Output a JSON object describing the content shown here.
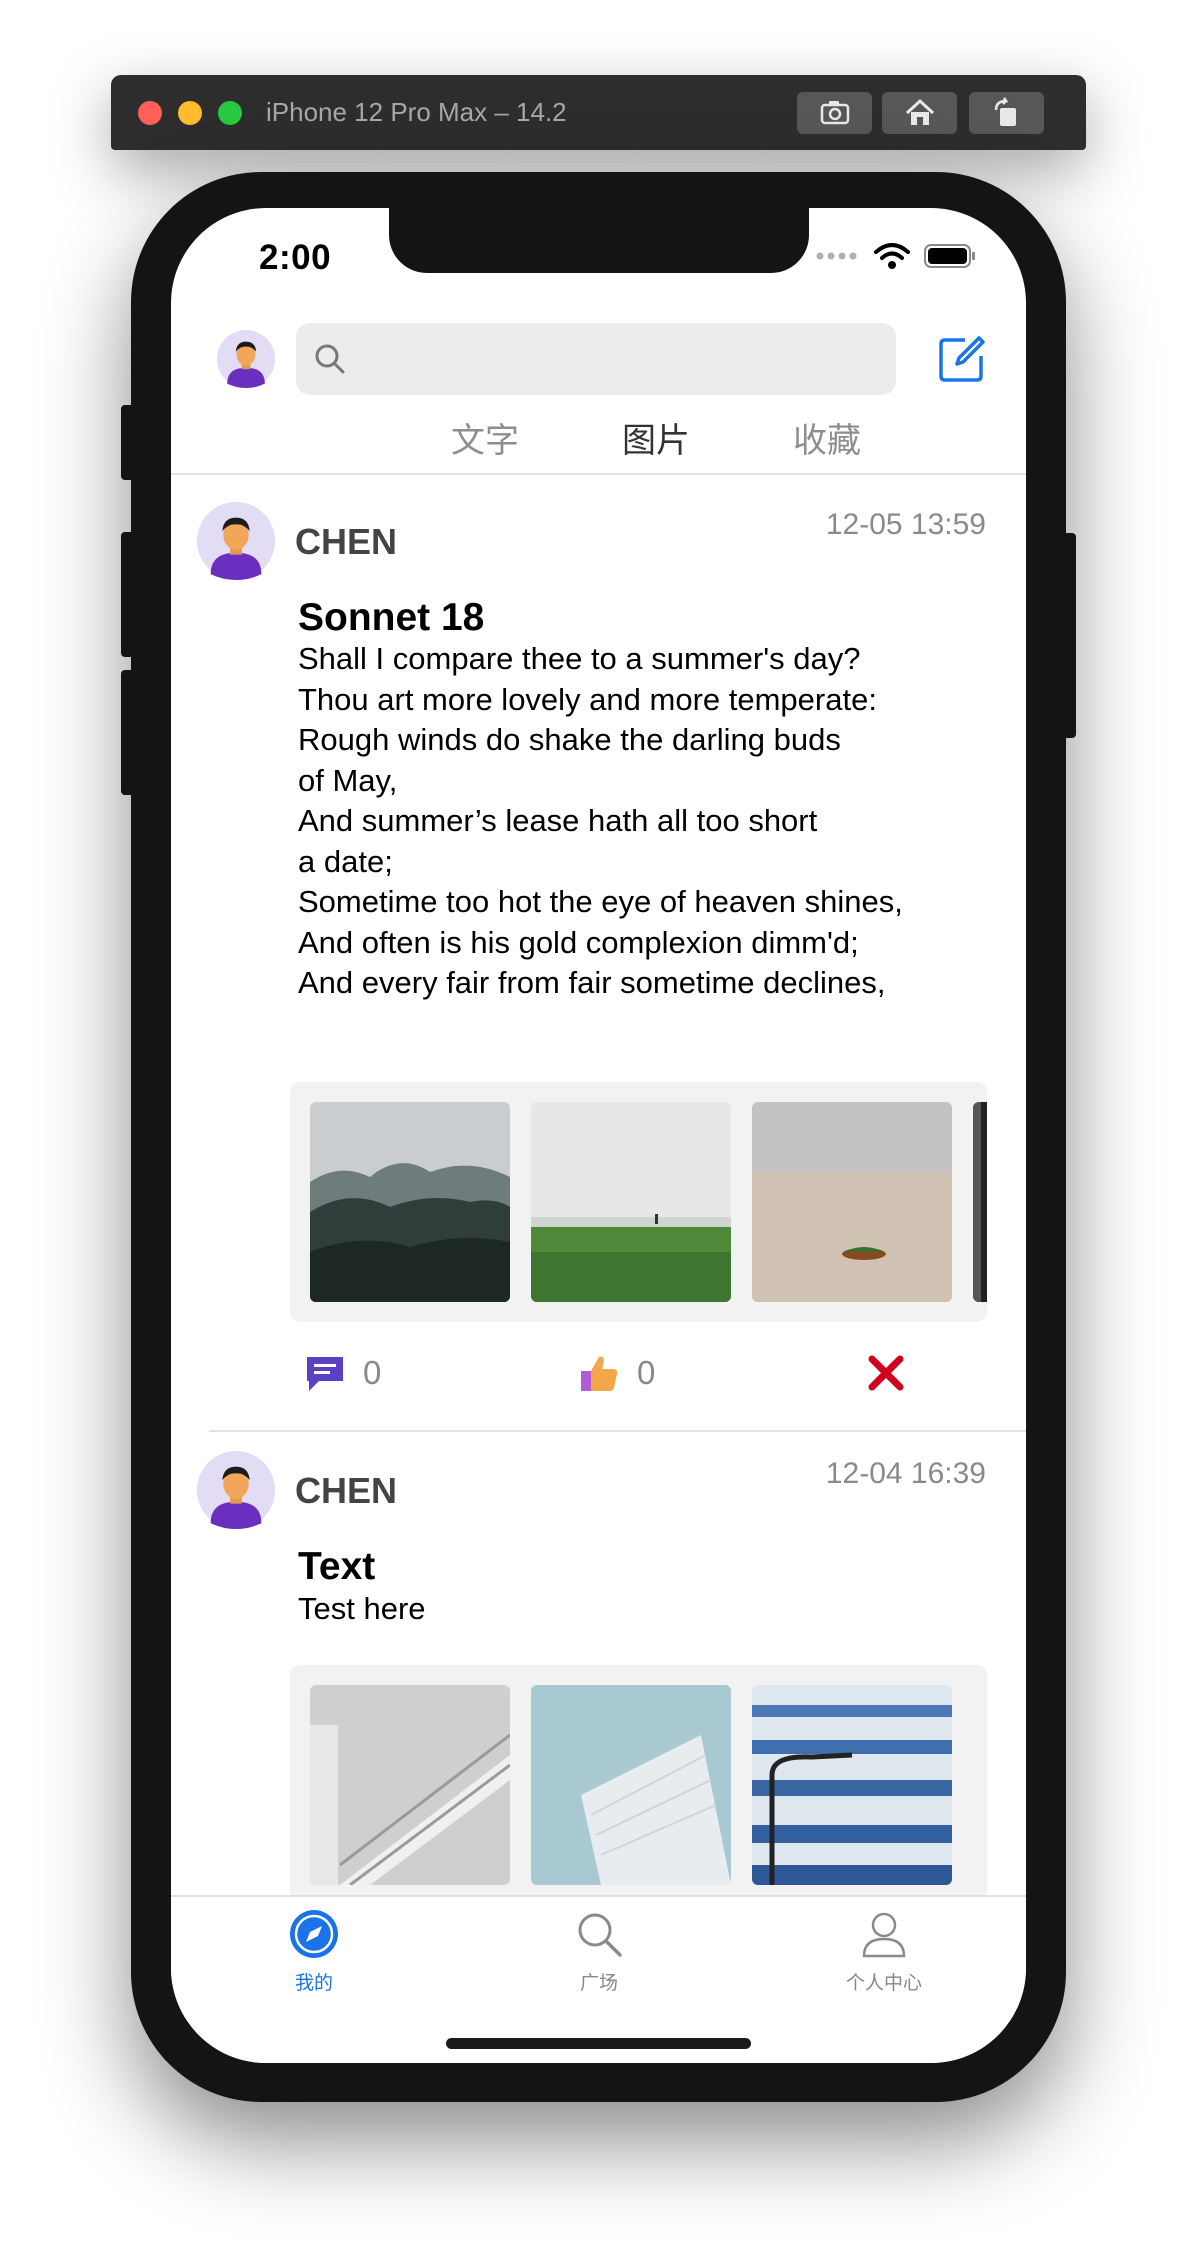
{
  "simulator": {
    "title": "iPhone 12 Pro Max – 14.2",
    "buttons": [
      "screenshot-icon",
      "home-icon",
      "rotate-icon"
    ]
  },
  "status_bar": {
    "time": "2:00"
  },
  "search": {
    "placeholder": ""
  },
  "tabs": [
    {
      "label": "文字",
      "active": false
    },
    {
      "label": "图片",
      "active": true
    },
    {
      "label": "收藏",
      "active": false
    }
  ],
  "posts": [
    {
      "user": "CHEN",
      "time": "12-05 13:59",
      "title": "Sonnet 18",
      "body": "Shall I compare thee to a summer's day?\nThou art more lovely and more temperate:\nRough winds do shake the darling buds\nof May,\nAnd summer’s lease hath all too short\na date;\nSometime too hot the eye of heaven shines,\nAnd often is his gold complexion dimm'd;\nAnd every fair from fair sometime declines,",
      "comments": "0",
      "likes": "0"
    },
    {
      "user": "CHEN",
      "time": "12-04 16:39",
      "title": "Text",
      "body": "Test here"
    }
  ],
  "tabbar": [
    {
      "label": "我的",
      "icon": "compass-icon",
      "active": true
    },
    {
      "label": "广场",
      "icon": "search-icon",
      "active": false
    },
    {
      "label": "个人中心",
      "icon": "person-icon",
      "active": false
    }
  ],
  "colors": {
    "accent": "#1a73e8",
    "delete": "#d0021b",
    "comment_icon": "#5b3fc4"
  }
}
